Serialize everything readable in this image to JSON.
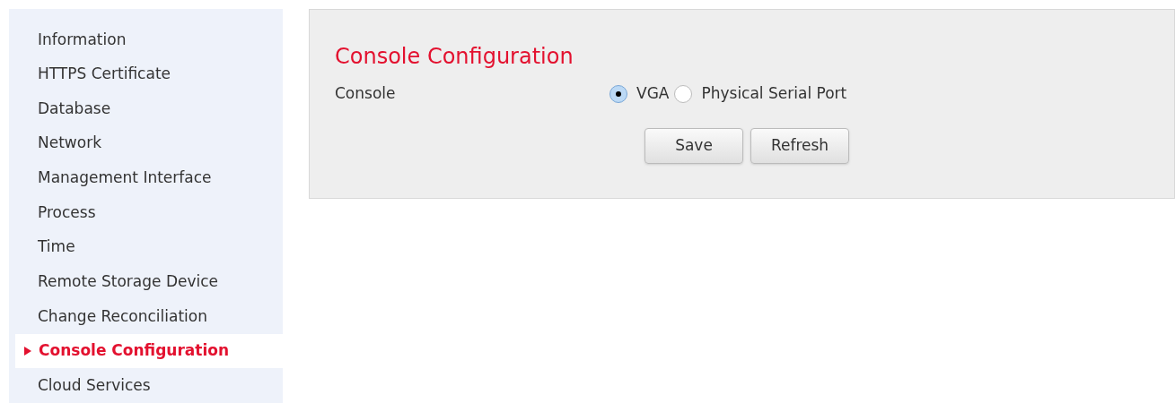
{
  "sidebar": {
    "items": [
      {
        "label": "Information",
        "selected": false
      },
      {
        "label": "HTTPS Certificate",
        "selected": false
      },
      {
        "label": "Database",
        "selected": false
      },
      {
        "label": "Network",
        "selected": false
      },
      {
        "label": "Management Interface",
        "selected": false
      },
      {
        "label": "Process",
        "selected": false
      },
      {
        "label": "Time",
        "selected": false
      },
      {
        "label": "Remote Storage Device",
        "selected": false
      },
      {
        "label": "Change Reconciliation",
        "selected": false
      },
      {
        "label": "Console Configuration",
        "selected": true
      },
      {
        "label": "Cloud Services",
        "selected": false
      }
    ]
  },
  "panel": {
    "title": "Console Configuration",
    "field_label": "Console",
    "options": [
      {
        "label": "VGA",
        "selected": true
      },
      {
        "label": "Physical Serial Port",
        "selected": false
      }
    ],
    "buttons": [
      "Save",
      "Refresh"
    ]
  }
}
